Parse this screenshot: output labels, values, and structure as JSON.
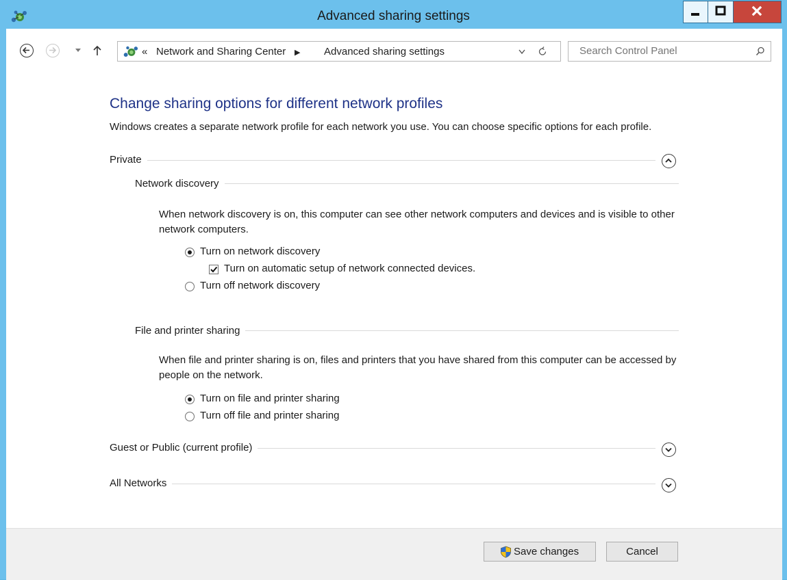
{
  "window": {
    "title": "Advanced sharing settings"
  },
  "icons": {
    "app": "network-sharing-icon",
    "minimize": "minimize-icon",
    "maximize": "maximize-icon",
    "close": "close-icon",
    "back": "back-arrow-icon",
    "forward": "forward-arrow-icon",
    "recent": "chevron-down-icon",
    "up": "up-arrow-icon",
    "location": "network-sharing-icon",
    "refresh": "refresh-icon",
    "search": "search-icon",
    "shield": "uac-shield-icon"
  },
  "address_bar": {
    "overflow": "«",
    "crumbs": [
      "Network and Sharing Center",
      "Advanced sharing settings"
    ],
    "separator": "▶",
    "dropdown": "⌄"
  },
  "search": {
    "placeholder": "Search Control Panel"
  },
  "page": {
    "heading": "Change sharing options for different network profiles",
    "description": "Windows creates a separate network profile for each network you use. You can choose specific options for each profile."
  },
  "profiles": {
    "private": {
      "label": "Private",
      "expanded": true,
      "network_discovery": {
        "label": "Network discovery",
        "description": "When network discovery is on, this computer can see other network computers and devices and is visible to other network computers.",
        "options": {
          "on": {
            "label": "Turn on network discovery",
            "selected": true
          },
          "auto_setup": {
            "label": "Turn on automatic setup of network connected devices.",
            "checked": true
          },
          "off": {
            "label": "Turn off network discovery",
            "selected": false
          }
        }
      },
      "file_sharing": {
        "label": "File and printer sharing",
        "description": "When file and printer sharing is on, files and printers that you have shared from this computer can be accessed by people on the network.",
        "options": {
          "on": {
            "label": "Turn on file and printer sharing",
            "selected": true
          },
          "off": {
            "label": "Turn off file and printer sharing",
            "selected": false
          }
        }
      }
    },
    "guest": {
      "label": "Guest or Public (current profile)",
      "expanded": false
    },
    "all": {
      "label": "All Networks",
      "expanded": false
    }
  },
  "footer": {
    "save_label": "Save changes",
    "cancel_label": "Cancel"
  },
  "colors": {
    "window_frame": "#6cc0ec",
    "heading": "#1e3287",
    "close_button": "#c7463c",
    "footer": "#f0f0f0"
  }
}
